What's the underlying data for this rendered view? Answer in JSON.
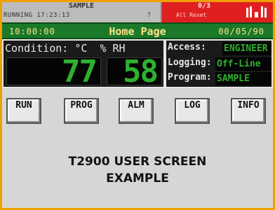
{
  "status": {
    "program": "SAMPLE",
    "state": "RUNNING",
    "clock": "17:23:13",
    "indicator": "?",
    "alarm_count": "0/3",
    "alarm_text": "All Reset"
  },
  "header": {
    "time": "10:00:00",
    "title": "Home Page",
    "date": "00/05/90"
  },
  "condition": {
    "label": "Condition: °C  % RH",
    "temperature": "77",
    "humidity": "58"
  },
  "info": [
    {
      "label": "Access:",
      "value": "ENGINEER"
    },
    {
      "label": "Logging:",
      "value": "Off-Line"
    },
    {
      "label": "Program:",
      "value": "SAMPLE"
    }
  ],
  "buttons": [
    "RUN",
    "PROG",
    "ALM",
    "LOG",
    "INFO"
  ],
  "footer": {
    "line1": "T2900 USER SCREEN",
    "line2": "EXAMPLE"
  },
  "colors": {
    "frame": "#f0a000",
    "title_bar": "#1a7a2a",
    "lcd_text": "#2fb02f",
    "alarm_bg": "#e02020"
  }
}
